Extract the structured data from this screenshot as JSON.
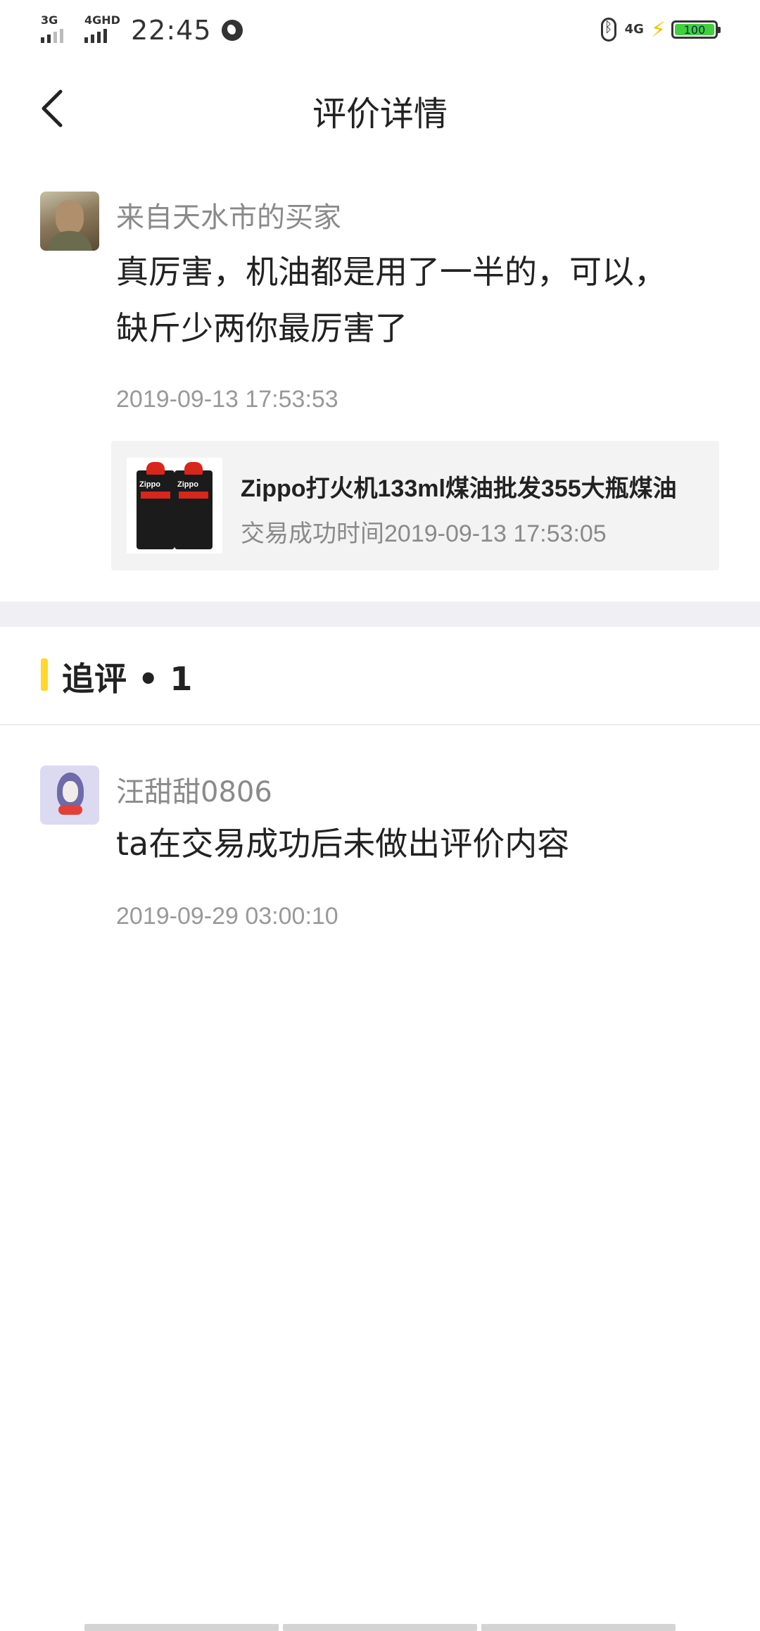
{
  "status_bar": {
    "network_1": "3G",
    "network_2": "4GHD",
    "time": "22:45",
    "network_3": "4G",
    "battery": "100"
  },
  "header": {
    "title": "评价详情"
  },
  "review": {
    "author": "来自天水市的买家",
    "text_line_1": "真厉害，机油都是用了一半的，可以，",
    "text_line_2": "缺斤少两你最厉害了",
    "timestamp": "2019-09-13 17:53:53",
    "product": {
      "name": "Zippo打火机133ml煤油批发355大瓶煤油",
      "trade_time": "交易成功时间2019-09-13 17:53:05",
      "thumb_brand": "Zippo"
    }
  },
  "followups": {
    "title": "追评 • 1",
    "items": [
      {
        "author": "汪甜甜0806",
        "text": "ta在交易成功后未做出评价内容",
        "timestamp": "2019-09-29 03:00:10"
      }
    ]
  },
  "colors": {
    "accent": "#ffd82b",
    "divider_band": "#efeff4",
    "card_background": "#f3f3f3",
    "battery_fill": "#3fcf3f"
  },
  "icons": [
    "back-arrow-icon",
    "globe-icon",
    "bluetooth-icon",
    "charging-bolt-icon",
    "battery-icon",
    "signal-bars-icon"
  ]
}
